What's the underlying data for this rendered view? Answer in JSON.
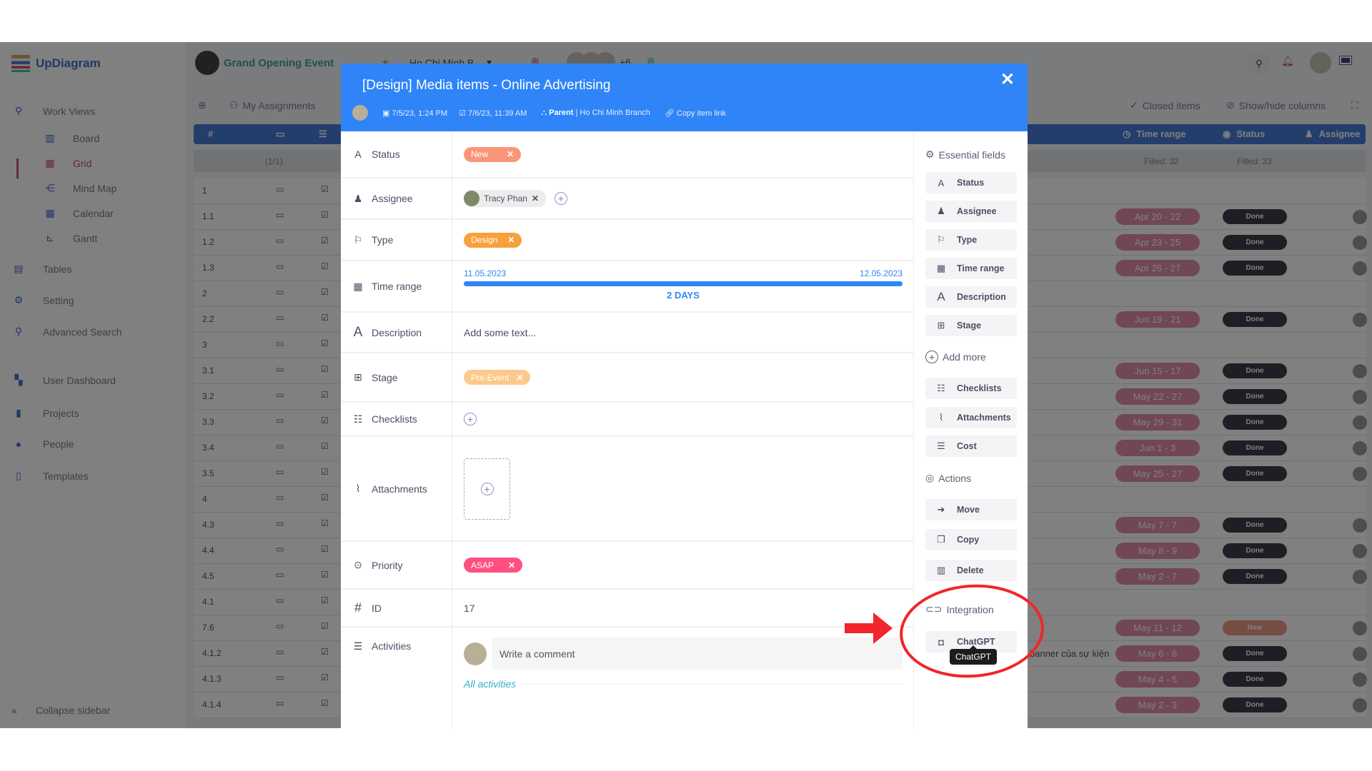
{
  "app": {
    "logo": "UpDiagram",
    "project": "Grand Opening Event",
    "branch_select": "Ho Chi Minh B...",
    "members_more": "+6",
    "sidebar": {
      "work_views": "Work Views",
      "views": [
        "Board",
        "Grid",
        "Mind Map",
        "Calendar",
        "Gantt"
      ],
      "active_view": "Grid",
      "items": [
        "Tables",
        "Setting",
        "Advanced Search"
      ],
      "items2": [
        "User Dashboard",
        "Projects",
        "People",
        "Templates"
      ],
      "collapse": "Collapse sidebar"
    },
    "toolbar": {
      "my_assignments": "My Assignments",
      "closed_items": "Closed items",
      "show_hide": "Show/hide columns"
    },
    "grid": {
      "headers": {
        "num": "#",
        "time_range": "Time range",
        "status": "Status",
        "assignee": "Assignee"
      },
      "filled": {
        "count": "(1/1)",
        "time_range": "Filled: 32",
        "status": "Filled: 33"
      },
      "rows": [
        {
          "id": "1",
          "time": "",
          "status": ""
        },
        {
          "id": "1.1",
          "time": "Apr 20 - 22",
          "status": "Done"
        },
        {
          "id": "1.2",
          "time": "Apr 23 - 25",
          "status": "Done"
        },
        {
          "id": "1.3",
          "time": "Apr 26 - 27",
          "status": "Done"
        },
        {
          "id": "2",
          "time": "",
          "status": ""
        },
        {
          "id": "2.2",
          "time": "Jun 19 - 21",
          "status": "Done"
        },
        {
          "id": "3",
          "time": "",
          "status": ""
        },
        {
          "id": "3.1",
          "time": "Jun 15 - 17",
          "status": "Done"
        },
        {
          "id": "3.2",
          "time": "May 22 - 27",
          "status": "Done"
        },
        {
          "id": "3.3",
          "time": "May 29 - 31",
          "status": "Done"
        },
        {
          "id": "3.4",
          "time": "Jun 1 - 3",
          "status": "Done"
        },
        {
          "id": "3.5",
          "time": "May 25 - 27",
          "status": "Done"
        },
        {
          "id": "4",
          "time": "",
          "status": ""
        },
        {
          "id": "4.3",
          "time": "May 7 - 7",
          "status": "Done"
        },
        {
          "id": "4.4",
          "time": "May 8 - 9",
          "status": "Done"
        },
        {
          "id": "4.5",
          "time": "May 2 - 7",
          "status": "Done"
        },
        {
          "id": "4.1",
          "time": "",
          "status": ""
        },
        {
          "id": "7.6",
          "time": "May 11 - 12",
          "status": "New"
        },
        {
          "id": "4.1.2",
          "time": "May 6 - 6",
          "status": "Done",
          "title": "banner của sự kiện"
        },
        {
          "id": "4.1.3",
          "time": "May 4 - 5",
          "status": "Done"
        },
        {
          "id": "4.1.4",
          "time": "May 2 - 3",
          "status": "Done"
        }
      ]
    }
  },
  "modal": {
    "title": "[Design] Media items - Online Advertising",
    "created": "7/5/23, 1:24 PM",
    "updated": "7/6/23, 11:39 AM",
    "parent_label": "Parent",
    "parent_value": "| Ho Chi Minh Branch",
    "copy_link": "Copy item link",
    "close": "✕",
    "fields": {
      "status": {
        "label": "Status",
        "value": "New",
        "color": "#f9967a"
      },
      "assignee": {
        "label": "Assignee",
        "value": "Tracy Phan"
      },
      "type": {
        "label": "Type",
        "value": "Design",
        "color": "#f7a03c"
      },
      "time_range": {
        "label": "Time range",
        "start": "11.05.2023",
        "end": "12.05.2023",
        "duration": "2 DAYS"
      },
      "description": {
        "label": "Description",
        "placeholder": "Add some text..."
      },
      "stage": {
        "label": "Stage",
        "value": "Pre-Event",
        "color": "#fcc98a"
      },
      "checklists": {
        "label": "Checklists"
      },
      "attachments": {
        "label": "Attachments"
      },
      "priority": {
        "label": "Priority",
        "value": "ASAP",
        "color": "#ff4f80"
      },
      "id": {
        "label": "ID",
        "value": "17"
      },
      "activities": {
        "label": "Activities",
        "comment_placeholder": "Write a comment",
        "all": "All activities"
      }
    },
    "panel": {
      "essential": "Essential fields",
      "essential_items": [
        "Status",
        "Assignee",
        "Type",
        "Time range",
        "Description",
        "Stage"
      ],
      "add_more": "Add more",
      "more_items": [
        "Checklists",
        "Attachments",
        "Cost"
      ],
      "actions": "Actions",
      "action_items": [
        "Move",
        "Copy",
        "Delete"
      ],
      "integration": "Integration",
      "chatgpt": "ChatGPT",
      "tooltip": "ChatGPT"
    }
  },
  "colors": {
    "primary": "#2f84f7",
    "annotation": "#f0262a"
  }
}
